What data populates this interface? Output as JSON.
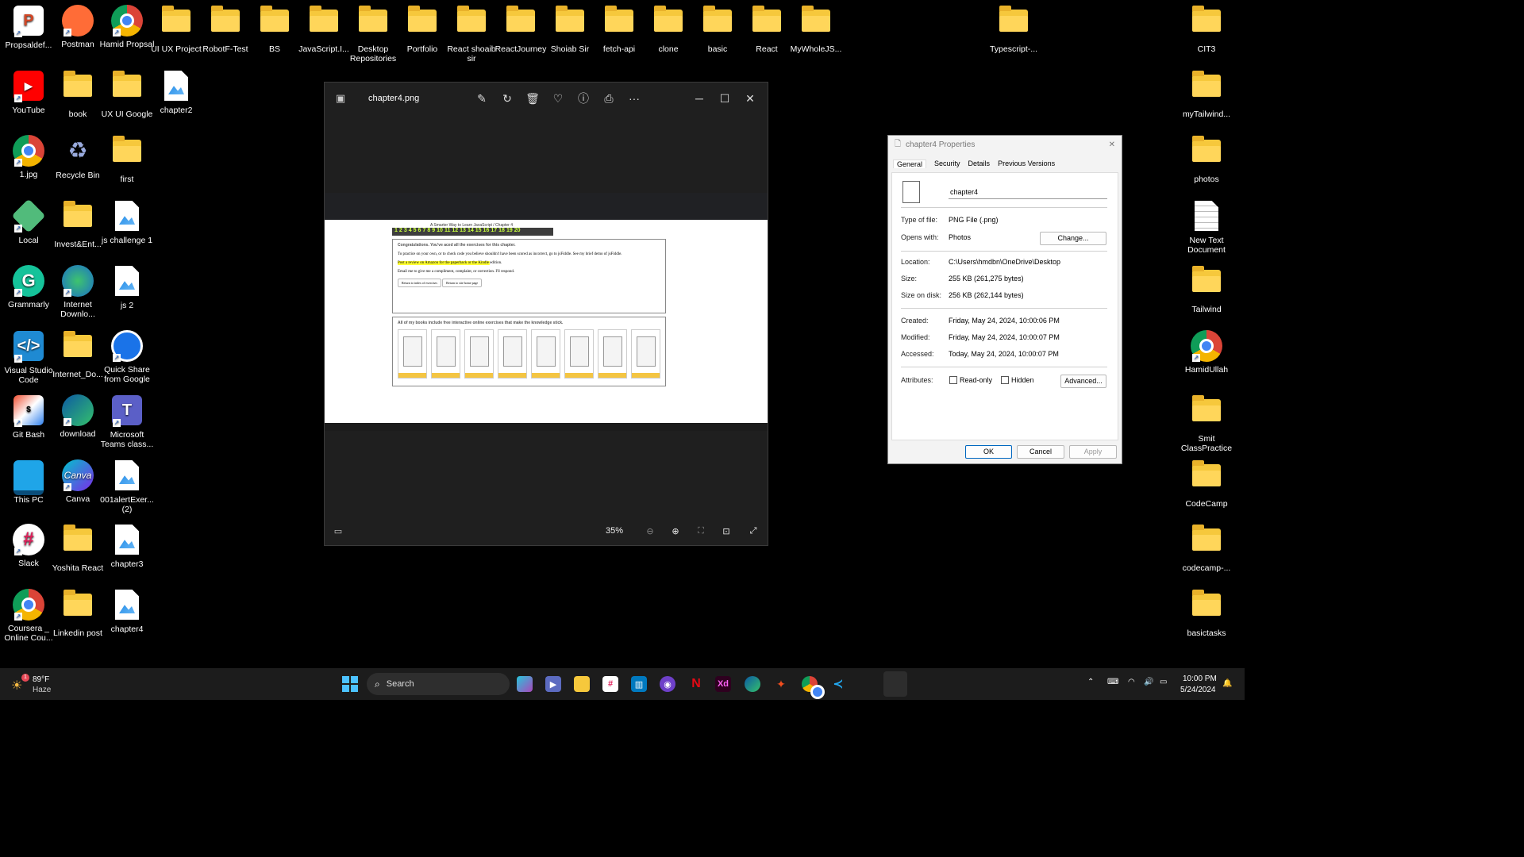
{
  "desktop_icons": [
    {
      "label": "Propsaldef...",
      "kind": "ppt"
    },
    {
      "label": "Postman",
      "kind": "postman"
    },
    {
      "label": "Hamid Propsal",
      "kind": "chrome"
    },
    {
      "label": "UI UX Project",
      "kind": "folder"
    },
    {
      "label": "RobotF-Test",
      "kind": "folder"
    },
    {
      "label": "BS",
      "kind": "folder"
    },
    {
      "label": "JavaScript.I...",
      "kind": "folder"
    },
    {
      "label": "Desktop Repositories",
      "kind": "folder"
    },
    {
      "label": "Portfolio",
      "kind": "folder"
    },
    {
      "label": "React shoaib sir",
      "kind": "folder"
    },
    {
      "label": "ReactJourney",
      "kind": "folder"
    },
    {
      "label": "Shoiab Sir",
      "kind": "folder"
    },
    {
      "label": "fetch-api",
      "kind": "folder"
    },
    {
      "label": "clone",
      "kind": "folder"
    },
    {
      "label": "basic",
      "kind": "folder"
    },
    {
      "label": "React",
      "kind": "folder"
    },
    {
      "label": "MyWholeJS...",
      "kind": "folder"
    },
    {
      "label": "Typescript-...",
      "kind": "folder"
    },
    {
      "label": "CIT3",
      "kind": "folder"
    },
    {
      "label": "YouTube",
      "kind": "youtube"
    },
    {
      "label": "book",
      "kind": "folder"
    },
    {
      "label": "UX UI Google",
      "kind": "folder"
    },
    {
      "label": "chapter2",
      "kind": "image"
    },
    {
      "label": "myTailwind...",
      "kind": "folder"
    },
    {
      "label": "1.jpg",
      "kind": "chrome"
    },
    {
      "label": "Recycle Bin",
      "kind": "recycle"
    },
    {
      "label": "first",
      "kind": "folder"
    },
    {
      "label": "photos",
      "kind": "folder"
    },
    {
      "label": "Local",
      "kind": "local"
    },
    {
      "label": "Invest&Ent...",
      "kind": "folder"
    },
    {
      "label": "js challenge 1",
      "kind": "image"
    },
    {
      "label": "New Text Document",
      "kind": "doc"
    },
    {
      "label": "Grammarly",
      "kind": "grammarly"
    },
    {
      "label": "Internet Downlo...",
      "kind": "idm"
    },
    {
      "label": "js 2",
      "kind": "image"
    },
    {
      "label": "Tailwind",
      "kind": "folder"
    },
    {
      "label": "Visual Studio Code",
      "kind": "vscode"
    },
    {
      "label": "Internet_Do...",
      "kind": "folder"
    },
    {
      "label": "Quick Share from Google",
      "kind": "quickshare"
    },
    {
      "label": "HamidUllah",
      "kind": "chrome"
    },
    {
      "label": "Git Bash",
      "kind": "gitbash"
    },
    {
      "label": "download",
      "kind": "edge"
    },
    {
      "label": "Microsoft Teams class...",
      "kind": "teams"
    },
    {
      "label": "Smit ClassPractice",
      "kind": "folder"
    },
    {
      "label": "This PC",
      "kind": "thispc"
    },
    {
      "label": "Canva",
      "kind": "canva"
    },
    {
      "label": "001alertExer... (2)",
      "kind": "image"
    },
    {
      "label": "CodeCamp",
      "kind": "folder"
    },
    {
      "label": "Slack",
      "kind": "slack"
    },
    {
      "label": "Yoshita React",
      "kind": "folder"
    },
    {
      "label": "chapter3",
      "kind": "image"
    },
    {
      "label": "codecamp-...",
      "kind": "folder"
    },
    {
      "label": "Coursera _ Online Cou...",
      "kind": "chrome"
    },
    {
      "label": "Linkedin post",
      "kind": "folder"
    },
    {
      "label": "chapter4",
      "kind": "image"
    },
    {
      "label": "basictasks",
      "kind": "folder"
    }
  ],
  "photos_window": {
    "title": "chapter4.png",
    "zoom": "35%",
    "toolbar_icons": [
      "edit-icon",
      "rotate-icon",
      "delete-icon",
      "favorite-icon",
      "info-icon",
      "print-icon",
      "more-icon"
    ],
    "inner_page": {
      "heading": "A Smarter Way to Learn JavaScript / Chapter 4",
      "chapters": [
        "1",
        "2",
        "3",
        "4",
        "5",
        "6",
        "7",
        "8",
        "9",
        "10",
        "11",
        "12",
        "13",
        "14",
        "15",
        "16",
        "17",
        "18",
        "19",
        "20"
      ],
      "congrats": "Congratulations. You've aced all the exercises for this chapter.",
      "line1": "To practice on your own, or to check code you believe shouldn't have been scored as incorrect, go to jsFiddle. See my brief demo of jsFiddle.",
      "line2": "Post a review on Amazon for the paperback or the Kindle edition.",
      "line3": "Email me to give me a compliment, complaint, or correction. I'll respond.",
      "btn1": "Return to index of exercises",
      "btn2": "Return to site home page",
      "books_heading": "All of my books include free interactive online exercises that make the knowledge stick.",
      "book_brand": "amazon",
      "book_count": 8
    }
  },
  "properties_dialog": {
    "title": "chapter4 Properties",
    "tabs": [
      "General",
      "Security",
      "Details",
      "Previous Versions"
    ],
    "active_tab": "General",
    "filename": "chapter4",
    "type_label": "Type of file:",
    "type_value": "PNG File (.png)",
    "opens_label": "Opens with:",
    "opens_value": "Photos",
    "change_btn": "Change...",
    "location_label": "Location:",
    "location_value": "C:\\Users\\hmdbn\\OneDrive\\Desktop",
    "size_label": "Size:",
    "size_value": "255 KB (261,275 bytes)",
    "disk_label": "Size on disk:",
    "disk_value": "256 KB (262,144 bytes)",
    "created_label": "Created:",
    "created_value": "Friday, May 24, 2024, 10:00:06 PM",
    "modified_label": "Modified:",
    "modified_value": "Friday, May 24, 2024, 10:00:07 PM",
    "accessed_label": "Accessed:",
    "accessed_value": "Today, May 24, 2024, 10:00:07 PM",
    "attributes_label": "Attributes:",
    "readonly_label": "Read-only",
    "hidden_label": "Hidden",
    "advanced_btn": "Advanced...",
    "ok_btn": "OK",
    "cancel_btn": "Cancel",
    "apply_btn": "Apply"
  },
  "taskbar": {
    "weather_temp": "89°F",
    "weather_cond": "Haze",
    "weather_badge": "1",
    "search_placeholder": "Search",
    "time": "10:00 PM",
    "date": "5/24/2024",
    "apps": [
      "start-icon",
      "copilot-icon",
      "meet-icon",
      "file-explorer-icon",
      "slack-icon",
      "trello-icon",
      "github-icon",
      "netflix-icon",
      "xd-icon",
      "edge-icon",
      "figma-icon",
      "chrome-icon",
      "vscode-icon",
      "active-window-icon"
    ]
  },
  "colors": {
    "folder": "#f6c83c",
    "accent": "#0067c0",
    "highlight": "#ffff33",
    "chapter_bar": "#3d3d3d",
    "chapter_text": "#c8ff3c"
  }
}
